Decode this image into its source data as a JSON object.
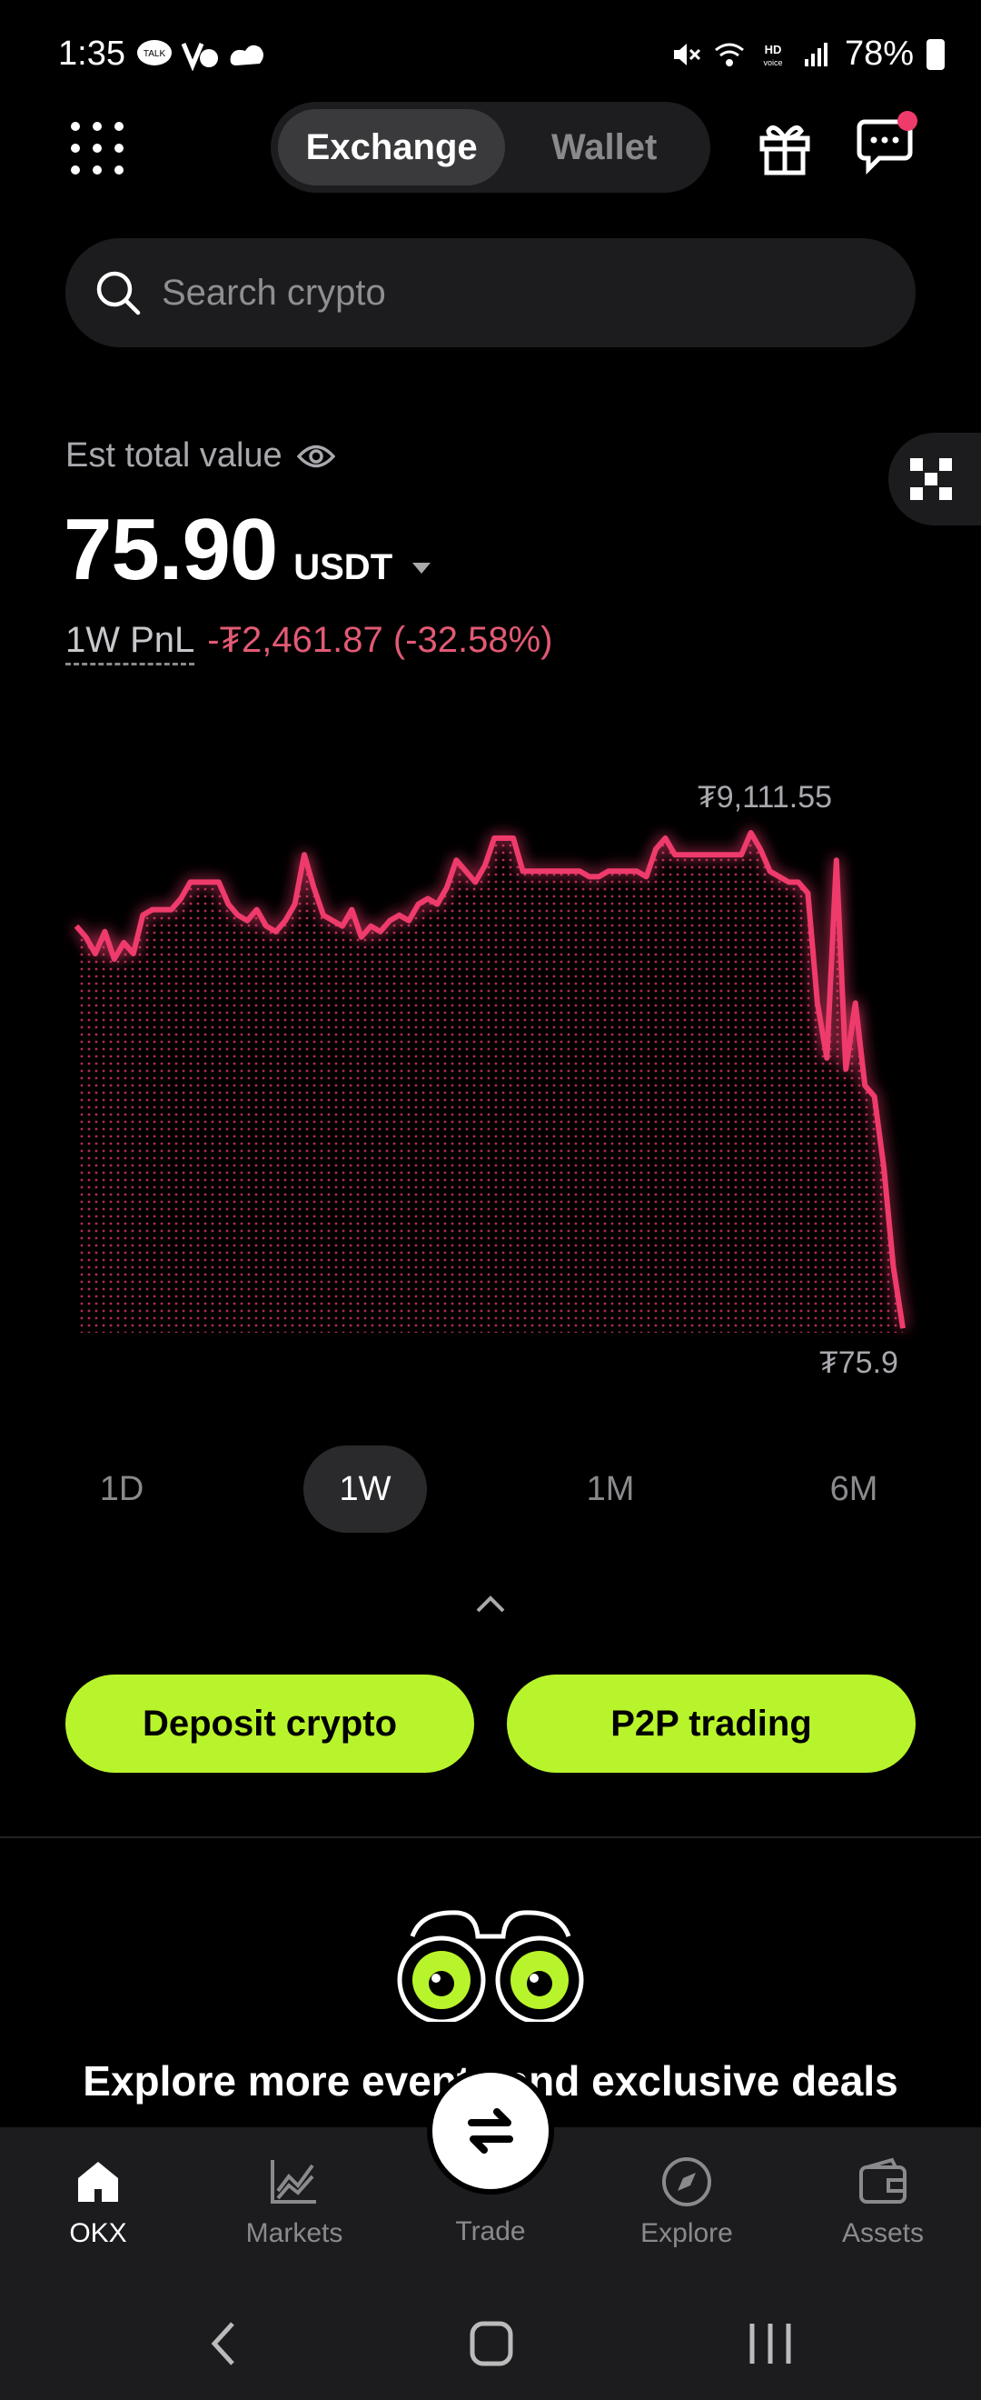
{
  "status_bar": {
    "time": "1:35",
    "battery": "78%",
    "icons": [
      "talk-icon",
      "volte-icon",
      "cloud-icon",
      "mute-icon",
      "wifi-icon",
      "hd-voice-icon",
      "signal-icon",
      "battery-icon"
    ]
  },
  "header": {
    "tabs": [
      "Exchange",
      "Wallet"
    ],
    "active_tab": "Exchange"
  },
  "search": {
    "placeholder": "Search crypto"
  },
  "portfolio": {
    "label": "Est total value",
    "value": "75.90",
    "currency": "USDT",
    "pnl_label": "1W PnL",
    "pnl_value": "-₮2,461.87 (-32.58%)"
  },
  "chart_data": {
    "type": "area",
    "max_label": "₮9,111.55",
    "min_label": "₮75.9",
    "color": "#ef3b6c",
    "values": [
      7400,
      7200,
      6900,
      7300,
      6800,
      7100,
      6900,
      7600,
      7700,
      7700,
      7700,
      7900,
      8200,
      8200,
      8200,
      8200,
      7800,
      7600,
      7500,
      7700,
      7400,
      7300,
      7500,
      7800,
      8700,
      8100,
      7600,
      7500,
      7400,
      7700,
      7200,
      7400,
      7300,
      7500,
      7600,
      7500,
      7800,
      7900,
      7800,
      8100,
      8600,
      8400,
      8200,
      8500,
      9000,
      9000,
      9000,
      8400,
      8400,
      8400,
      8400,
      8400,
      8400,
      8400,
      8300,
      8300,
      8400,
      8400,
      8400,
      8400,
      8300,
      8800,
      9000,
      8700,
      8700,
      8700,
      8700,
      8700,
      8700,
      8700,
      8700,
      9100,
      8800,
      8400,
      8300,
      8200,
      8200,
      8000,
      6000,
      5000,
      8600,
      4800,
      6000,
      4500,
      4300,
      3000,
      1200,
      80
    ]
  },
  "ranges": [
    "1D",
    "1W",
    "1M",
    "6M"
  ],
  "active_range": "1W",
  "actions": {
    "deposit": "Deposit crypto",
    "p2p": "P2P trading"
  },
  "promo": {
    "text": "Explore more events and exclusive deals"
  },
  "bottom_nav": [
    {
      "label": "OKX",
      "icon": "home-icon",
      "active": true
    },
    {
      "label": "Markets",
      "icon": "markets-icon",
      "active": false
    },
    {
      "label": "Trade",
      "icon": "trade-icon",
      "active": false
    },
    {
      "label": "Explore",
      "icon": "compass-icon",
      "active": false
    },
    {
      "label": "Assets",
      "icon": "wallet-icon",
      "active": false
    }
  ],
  "colors": {
    "accent": "#b8f42b",
    "loss": "#e25a74",
    "chart": "#ef3b6c"
  }
}
